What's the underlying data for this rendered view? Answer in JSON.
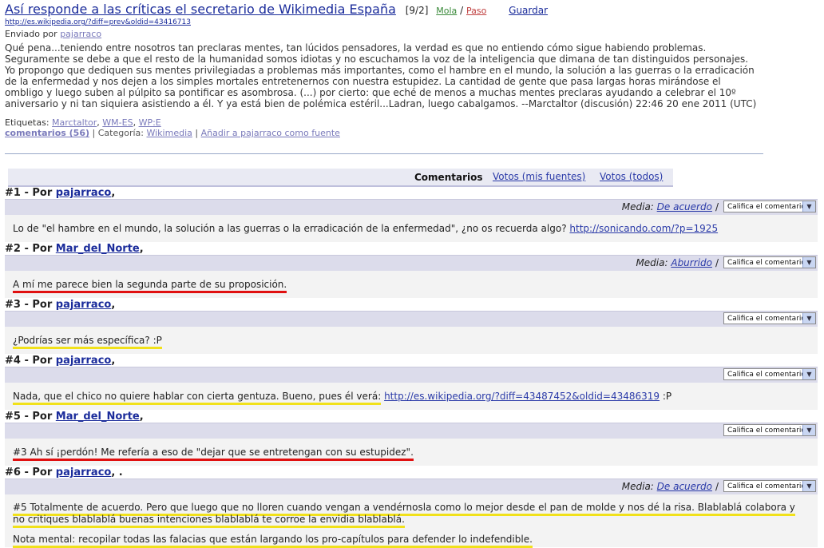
{
  "story": {
    "title": "Así responde a las críticas el secretario de Wikimedia España",
    "score": "[9/2]",
    "mola": "Mola",
    "slash": "/",
    "paso": "Paso",
    "guardar": "Guardar",
    "url": "http://es.wikipedia.org/?diff=prev&oldid=43416713",
    "sent_by_label": "Enviado por",
    "sent_by_user": "pajarraco",
    "body": "Qué pena...teniendo entre nosotros tan preclaras mentes, tan lúcidos pensadores, la verdad es que no entiendo cómo sigue habiendo problemas. Seguramente se debe a que el resto de la humanidad somos idiotas y no escuchamos la voz de la inteligencia que dimana de tan distinguidos personajes. Yo propongo que dediquen sus mentes privilegiadas a problemas más importantes, como el hambre en el mundo, la solución a las guerras o la erradicación de la enfermedad y nos dejen a los simples mortales entretenernos con nuestra estupidez. La cantidad de gente que pasa largas horas mirándose el ombligo y luego suben al púlpito sa pontificar es asombrosa. (...) por cierto: que eché de menos a muchas mentes preclaras ayudando a celebrar el 10º aniversario y ni tan siquiera asistiendo a él. Y ya está bien de polémica estéril...Ladran, luego cabalgamos. --Marctaltor (discusión) 22:46 20 ene 2011 (UTC)",
    "tags_label": "Etiquetas:",
    "tags": [
      "Marctaltor",
      "WM-ES",
      "WP:E"
    ],
    "comments_count": "comentarios (56)",
    "category_label": "Categoría:",
    "category": "Wikimedia",
    "add_source": "Añadir a pajarraco como fuente"
  },
  "tabs": {
    "comentarios": "Comentarios",
    "votos_mis": "Votos (mis fuentes)",
    "votos_todos": "Votos (todos)"
  },
  "rate_label": "Califica el comentario",
  "media_label": "Media:",
  "comments": [
    {
      "num": "#1 - Por",
      "author": "pajarraco",
      "trail": ",",
      "media": "De acuerdo",
      "text": "Lo de \"el hambre en el mundo, la solución a las guerras o la erradicación de la enfermedad\", ¿no os recuerda algo?",
      "link": "http://sonicando.com/?p=1925"
    },
    {
      "num": "#2 - Por",
      "author": "Mar_del_Norte",
      "trail": ",",
      "media": "Aburrido",
      "text": "A mí me parece bien la segunda parte de su proposición."
    },
    {
      "num": "#3 - Por",
      "author": "pajarraco",
      "trail": ",",
      "text": "¿Podrías ser más específica? :P"
    },
    {
      "num": "#4 - Por",
      "author": "pajarraco",
      "trail": ",",
      "text": "Nada, que el chico no quiere hablar con cierta gentuza. Bueno, pues él verá:",
      "link": "http://es.wikipedia.org/?diff=43487452&oldid=43486319",
      "tail": ":P"
    },
    {
      "num": "#5 - Por",
      "author": "Mar_del_Norte",
      "trail": ",",
      "text": "#3 Ah sí ¡perdón! Me refería a eso de \"dejar que se entretengan con su estupidez\"."
    },
    {
      "num": "#6 - Por",
      "author": "pajarraco",
      "trail": ", .",
      "media": "De acuerdo",
      "text": "#5 Totalmente de acuerdo. Pero que luego que no lloren cuando vengan a vendérnosla como lo mejor desde el pan de molde y nos dé la risa. Blablablá colabora y no critiques blablablá buenas intenciones blablablá te corroe la envidia blablablá.",
      "text2": "Nota mental: recopilar todas las falacias que están largando los pro-capítulos para defender lo indefendible."
    }
  ]
}
